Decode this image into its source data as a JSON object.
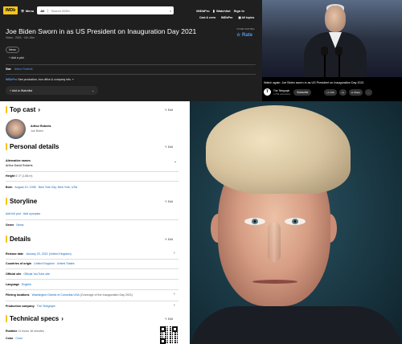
{
  "header": {
    "logo": "IMDb",
    "menu_label": "Menu",
    "search_scope": "All",
    "search_placeholder": "Search IMDb",
    "imdbpro": "IMDbPro",
    "watchlist": "Watchlist",
    "signin": "Sign In",
    "subnav": [
      "Cast & crew",
      "IMDbPro",
      "All topics"
    ]
  },
  "title_block": {
    "title": "Joe Biden Sworn in as US President on Inauguration Day 2021",
    "meta": "Video · 2021 · 11h 16m",
    "your_rating_label": "YOUR RATING",
    "rate_label": "Rate",
    "genre_chip": "News",
    "add_plot": "Add a plot",
    "star_label": "Star",
    "star_name": "Arthur Roberts",
    "pro_label": "IMDbPro",
    "pro_text": "See production, box office & company info",
    "watchlist_button": "Add to Watchlist"
  },
  "video": {
    "title": "Watch again: Joe Biden sworn in as US President on Inauguration Day 2021",
    "channel": "The Telegraph",
    "subscribers": "4.37M subscribers",
    "subscribe": "Subscribe",
    "likes": "13K",
    "share": "Share"
  },
  "details_page": {
    "edit_label": "Edit",
    "top_cast": {
      "title": "Top cast",
      "actor": "Arthur Roberts",
      "role": "Joe Biden"
    },
    "personal": {
      "title": "Personal details",
      "alt_names_label": "Alternative names",
      "alt_names_value": "Arthur David Roberts",
      "height_label": "Height",
      "height_value": "6′ 2″ (1.88 m)",
      "born_label": "Born",
      "born_date": "August 10, 1938",
      "born_place": "New York City, New York, USA"
    },
    "storyline": {
      "title": "Storyline",
      "add_plot": "Add full plot",
      "add_synopsis": "Add synopsis",
      "genres_label": "Genre",
      "genres_value": "News"
    },
    "details": {
      "title": "Details",
      "release_label": "Release date",
      "release_value": "January 20, 2021 (United Kingdom)",
      "origin_label": "Countries of origin",
      "origin_value": "United Kingdom · United States",
      "site_label": "Official site",
      "site_value": "Official YouTube site",
      "language_label": "Language",
      "language_value": "English",
      "filming_label": "Filming locations",
      "filming_value": "Washington District of Columbia USA",
      "filming_note": "(Coverage of the Inauguration Day 2021)",
      "company_label": "Production company",
      "company_value": "The Telegraph"
    },
    "tech": {
      "title": "Technical specs",
      "runtime_label": "Runtime",
      "runtime_value": "11 hours 16 minutes",
      "color_label": "Color",
      "color_value": "Color"
    }
  }
}
